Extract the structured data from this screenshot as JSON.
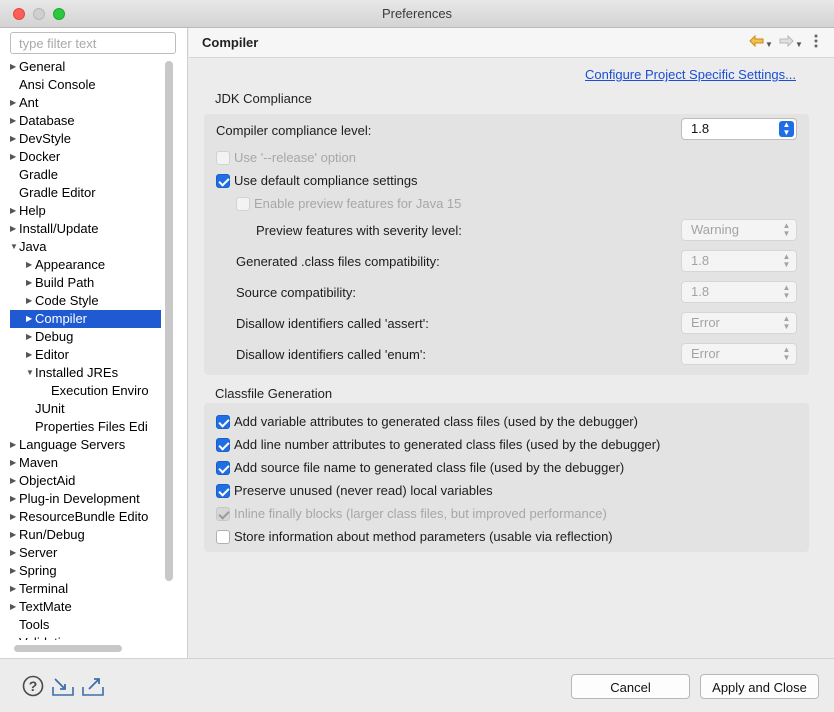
{
  "window": {
    "title": "Preferences"
  },
  "filter": {
    "placeholder": "type filter text"
  },
  "tree": [
    {
      "label": "General",
      "expandable": true,
      "depth": 0
    },
    {
      "label": "Ansi Console",
      "expandable": false,
      "depth": 0
    },
    {
      "label": "Ant",
      "expandable": true,
      "depth": 0
    },
    {
      "label": "Database",
      "expandable": true,
      "depth": 0
    },
    {
      "label": "DevStyle",
      "expandable": true,
      "depth": 0
    },
    {
      "label": "Docker",
      "expandable": true,
      "depth": 0
    },
    {
      "label": "Gradle",
      "expandable": false,
      "depth": 0
    },
    {
      "label": "Gradle Editor",
      "expandable": false,
      "depth": 0
    },
    {
      "label": "Help",
      "expandable": true,
      "depth": 0
    },
    {
      "label": "Install/Update",
      "expandable": true,
      "depth": 0
    },
    {
      "label": "Java",
      "expandable": true,
      "expanded": true,
      "depth": 0
    },
    {
      "label": "Appearance",
      "expandable": true,
      "depth": 1
    },
    {
      "label": "Build Path",
      "expandable": true,
      "depth": 1
    },
    {
      "label": "Code Style",
      "expandable": true,
      "depth": 1
    },
    {
      "label": "Compiler",
      "expandable": true,
      "depth": 1,
      "selected": true
    },
    {
      "label": "Debug",
      "expandable": true,
      "depth": 1
    },
    {
      "label": "Editor",
      "expandable": true,
      "depth": 1
    },
    {
      "label": "Installed JREs",
      "expandable": true,
      "expanded": true,
      "depth": 1
    },
    {
      "label": "Execution Enviro",
      "expandable": false,
      "depth": 2
    },
    {
      "label": "JUnit",
      "expandable": false,
      "depth": 1
    },
    {
      "label": "Properties Files Edi",
      "expandable": false,
      "depth": 1
    },
    {
      "label": "Language Servers",
      "expandable": true,
      "depth": 0
    },
    {
      "label": "Maven",
      "expandable": true,
      "depth": 0
    },
    {
      "label": "ObjectAid",
      "expandable": true,
      "depth": 0
    },
    {
      "label": "Plug-in Development",
      "expandable": true,
      "depth": 0
    },
    {
      "label": "ResourceBundle Edito",
      "expandable": true,
      "depth": 0
    },
    {
      "label": "Run/Debug",
      "expandable": true,
      "depth": 0
    },
    {
      "label": "Server",
      "expandable": true,
      "depth": 0
    },
    {
      "label": "Spring",
      "expandable": true,
      "depth": 0
    },
    {
      "label": "Terminal",
      "expandable": true,
      "depth": 0
    },
    {
      "label": "TextMate",
      "expandable": true,
      "depth": 0
    },
    {
      "label": "Tools",
      "expandable": false,
      "depth": 0
    },
    {
      "label": "Validation",
      "expandable": false,
      "depth": 0
    }
  ],
  "page": {
    "title": "Compiler",
    "config_link": "Configure Project Specific Settings...",
    "nav": {
      "back_icon": "arrow-left-icon",
      "forward_icon": "arrow-right-icon",
      "menu_icon": "view-menu-icon"
    }
  },
  "jdk": {
    "group_title": "JDK Compliance",
    "compliance_label": "Compiler compliance level:",
    "compliance_value": "1.8",
    "release_option": {
      "label": "Use '--release' option",
      "checked": false,
      "enabled": false
    },
    "default_settings": {
      "label": "Use default compliance settings",
      "checked": true,
      "enabled": true
    },
    "preview_features": {
      "label": "Enable preview features for Java 15",
      "checked": false,
      "enabled": false
    },
    "preview_severity_label": "Preview features with severity level:",
    "preview_severity_value": "Warning",
    "class_compat_label": "Generated .class files compatibility:",
    "class_compat_value": "1.8",
    "source_compat_label": "Source compatibility:",
    "source_compat_value": "1.8",
    "assert_label": "Disallow identifiers called 'assert':",
    "assert_value": "Error",
    "enum_label": "Disallow identifiers called 'enum':",
    "enum_value": "Error"
  },
  "classfile": {
    "group_title": "Classfile Generation",
    "options": [
      {
        "label": "Add variable attributes to generated class files (used by the debugger)",
        "checked": true,
        "enabled": true
      },
      {
        "label": "Add line number attributes to generated class files (used by the debugger)",
        "checked": true,
        "enabled": true
      },
      {
        "label": "Add source file name to generated class file (used by the debugger)",
        "checked": true,
        "enabled": true
      },
      {
        "label": "Preserve unused (never read) local variables",
        "checked": true,
        "enabled": true
      },
      {
        "label": "Inline finally blocks (larger class files, but improved performance)",
        "checked": true,
        "enabled": false
      },
      {
        "label": "Store information about method parameters (usable via reflection)",
        "checked": false,
        "enabled": true
      }
    ]
  },
  "footer": {
    "help_icon": "help-icon",
    "import_icon": "import-icon",
    "export_icon": "export-icon",
    "cancel_label": "Cancel",
    "apply_close_label": "Apply and Close"
  }
}
